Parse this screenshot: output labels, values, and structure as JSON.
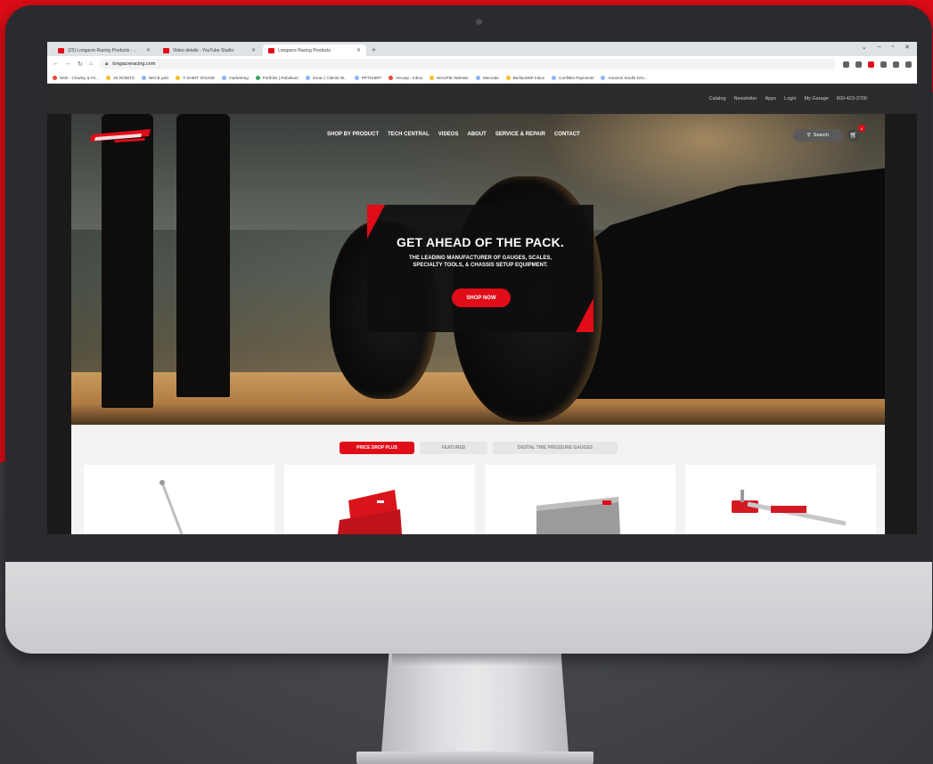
{
  "browser": {
    "tabs": [
      {
        "title": "(25) Longacre Racing Products - ...",
        "active": false
      },
      {
        "title": "Video details - YouTube Studio",
        "active": false
      },
      {
        "title": "Longacre Racing Products",
        "active": true
      }
    ],
    "new_tab": "+",
    "url": "longacreracing.com",
    "bookmarks": [
      "NKE - Charley & Fri...",
      "JE ROBITS",
      "NKCE pelz",
      "T-SHIRT SOUND",
      "marketneg",
      "Portfolio | Rebeliant",
      "Zoran | Clients W...",
      "PPTSHIRT",
      "rrecarp - Inbox",
      "MAGPIE Website",
      "Merceda",
      "BerliantWP Inbox",
      "Conflikts Payments",
      "Amazon Kindle Driv..."
    ]
  },
  "site": {
    "utility_links": [
      "Catalog",
      "Newsletter",
      "Apps",
      "Login",
      "My Garage",
      "800-423-3700"
    ],
    "nav": [
      "SHOP BY PRODUCT",
      "TECH CENTRAL",
      "VIDEOS",
      "ABOUT",
      "SERVICE & REPAIR",
      "CONTACT"
    ],
    "search_label": "Search",
    "cart_count": "0",
    "hero": {
      "headline": "GET AHEAD OF THE PACK.",
      "subtext": "THE LEADING MANUFACTURER OF GAUGES, SCALES, SPECIALTY TOOLS, & CHASSIS SETUP EQUIPMENT.",
      "cta": "SHOP NOW"
    },
    "product_tabs": [
      {
        "label": "PRICE DROP PLUS",
        "active": true
      },
      {
        "label": "FEATURED",
        "active": false
      },
      {
        "label": "DIGITAL TIRE PRESSURE GAUGES",
        "active": false
      }
    ]
  },
  "colors": {
    "accent": "#e00c17",
    "hero_box": "#0e0e0e",
    "utility_bar": "#2c2c2e"
  }
}
